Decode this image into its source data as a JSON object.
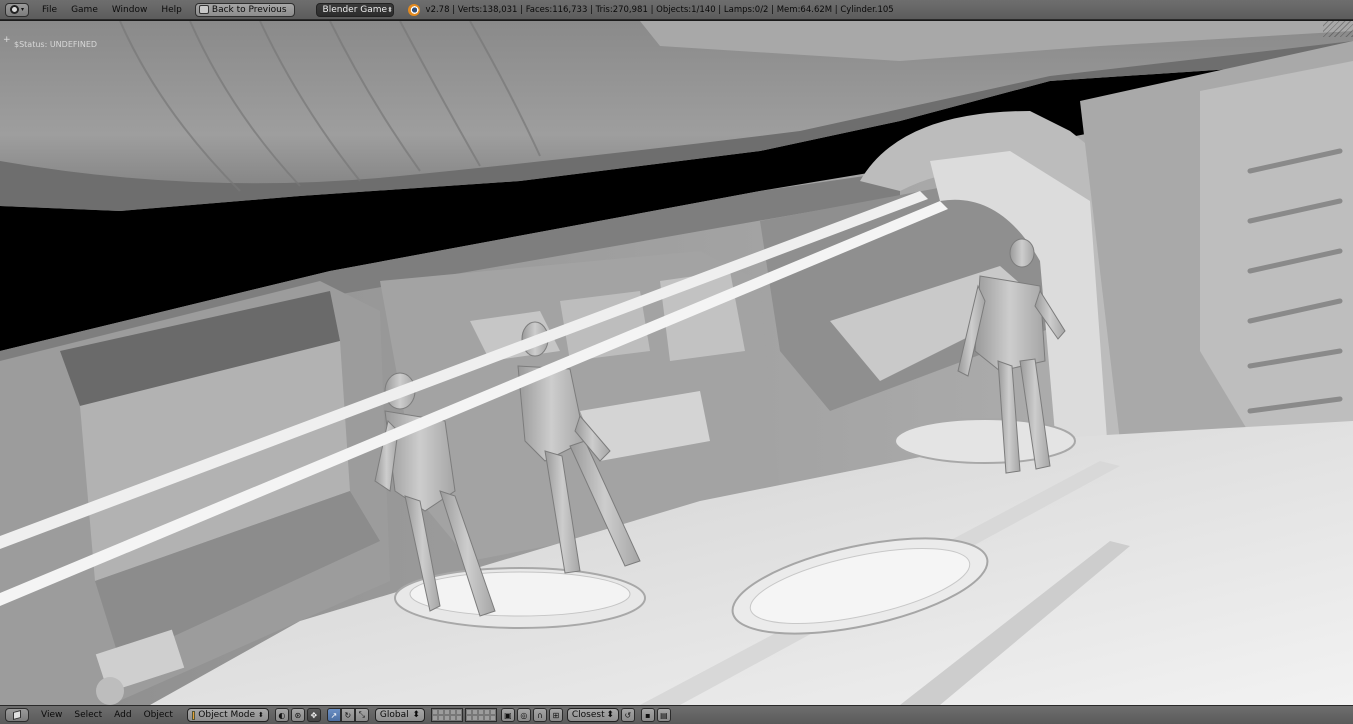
{
  "header": {
    "editor_icon": "info-icon",
    "menus": [
      "File",
      "Game",
      "Window",
      "Help"
    ],
    "back_button": "Back to Previous",
    "engine": "Blender Game",
    "stats": "v2.78 | Verts:138,031 | Faces:116,733 | Tris:270,981 | Objects:1/140 | Lamps:0/2 | Mem:64.62M | Cylinder.105"
  },
  "viewport": {
    "status": "$Status: UNDEFINED"
  },
  "footer": {
    "editor_icon": "3d-view-icon",
    "menus": [
      "View",
      "Select",
      "Add",
      "Object"
    ],
    "mode": "Object Mode",
    "orientation": "Global",
    "snap_target": "Closest"
  },
  "colors": {
    "header_bg": "#5e5e5e",
    "engine_bg": "#2f2f2f",
    "active_blue": "#5a7db4",
    "viewport_bg": "#000000"
  }
}
